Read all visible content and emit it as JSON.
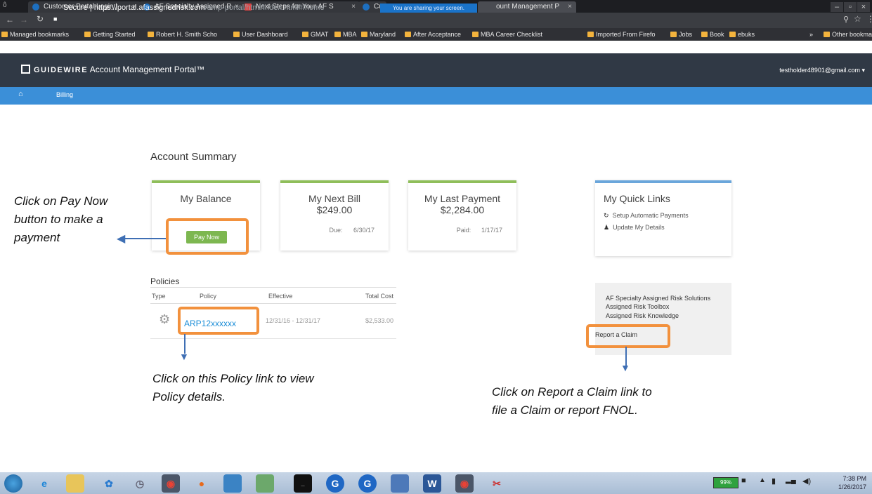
{
  "browser": {
    "tabs": [
      {
        "title": "Customer Portal Login | "
      },
      {
        "title": "AF Specialty Assigned R"
      },
      {
        "title": "Next Steps for Your AF S"
      },
      {
        "title": "Cus"
      },
      {
        "title": "ount Management P"
      }
    ],
    "share_banner": "You are sharing your screen.",
    "address": {
      "secure": "Secure",
      "host": "https://portal.afassignedrisk.com",
      "path": "/amp-portal/html/Index.html#/home"
    },
    "bookmarks": [
      "Managed bookmarks",
      "Getting Started",
      "Robert H. Smith Scho",
      "User Dashboard",
      "GMAT",
      "MBA",
      "Maryland",
      "After Acceptance",
      "MBA Career Checklist",
      "Imported From Firefo",
      "Jobs",
      "Book",
      "ebuks",
      "Other bookmarks"
    ],
    "bookmark_chevron": "»"
  },
  "app": {
    "brand": "GUIDEWIRE",
    "product": "Account Management Portal™",
    "user_email": "testholder48901@gmail.com ▾",
    "nav": {
      "billing": "Billing"
    }
  },
  "summary": {
    "heading": "Account Summary",
    "balance": {
      "title": "My Balance",
      "button": "Pay Now"
    },
    "next_bill": {
      "title": "My Next Bill",
      "amount": "$249.00",
      "due_label": "Due:",
      "due_date": "6/30/17"
    },
    "last_payment": {
      "title": "My Last Payment",
      "amount": "$2,284.00",
      "paid_label": "Paid:",
      "paid_date": "1/17/17"
    },
    "quick_links": {
      "title": "My Quick Links",
      "links": [
        "Setup Automatic Payments",
        "Update My Details"
      ]
    }
  },
  "policies": {
    "heading": "Policies",
    "columns": [
      "Type",
      "Policy",
      "Effective",
      "Total Cost"
    ],
    "rows": [
      {
        "policy": "ARP12xxxxxx",
        "effective": "12/31/16 - 12/31/17",
        "total": "$2,533.00"
      }
    ]
  },
  "side_links": [
    "AF Specialty Assigned Risk Solutions",
    "Assigned Risk Toolbox",
    "Assigned Risk Knowledge",
    "Report a Claim"
  ],
  "annotations": {
    "pay_now": [
      "Click on Pay Now",
      "button to make a",
      "payment"
    ],
    "policy": [
      "Click on this Policy link to view",
      "Policy details."
    ],
    "claim": [
      "Click on Report a Claim link to",
      "file a Claim or report FNOL."
    ]
  },
  "taskbar": {
    "battery": "99%",
    "time": "7:38 PM",
    "date": "1/26/2017"
  },
  "colors": {
    "accent_green": "#8fbe5a",
    "accent_blue": "#6aa6db",
    "annotation_orange": "#f2913d",
    "header_dark": "#303945",
    "nav_blue": "#3b8fd8"
  }
}
